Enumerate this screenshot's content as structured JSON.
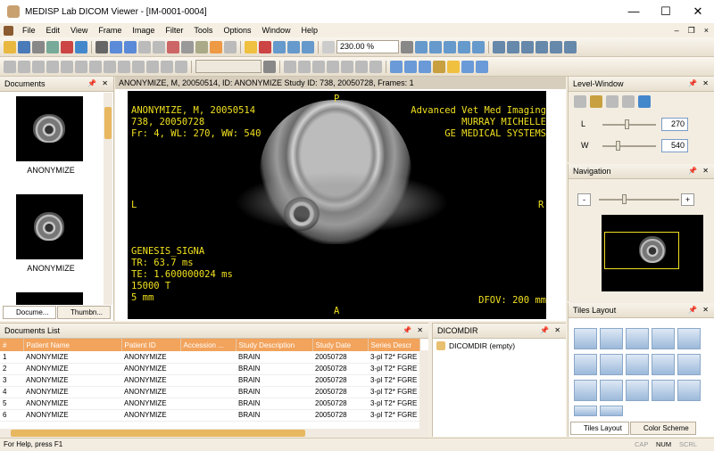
{
  "window": {
    "title": "MEDISP Lab DICOM Viewer - [IM-0001-0004]",
    "min": "—",
    "max": "☐",
    "close": "✕"
  },
  "menu": [
    "File",
    "Edit",
    "View",
    "Frame",
    "Image",
    "Filter",
    "Tools",
    "Options",
    "Window",
    "Help"
  ],
  "mdi": {
    "min": "–",
    "restore": "❐",
    "close": "×"
  },
  "toolbar": {
    "zoom": "230.00 %"
  },
  "documents": {
    "title": "Documents",
    "thumb_label_1": "ANONYMIZE",
    "thumb_label_2": "ANONYMIZE",
    "tab1": "Docume...",
    "tab2": "Thumbn..."
  },
  "viewer": {
    "header": "ANONYMIZE, M, 20050514, ID: ANONYMIZE   Study ID: 738, 20050728, Frames: 1",
    "top_left": "ANONYMIZE, M, 20050514\n738, 20050728\nFr: 4, WL: 270, WW: 540",
    "top_right": "Advanced Vet Med Imaging\nMURRAY MICHELLE\nGE MEDICAL SYSTEMS",
    "bottom_left": "GENESIS_SIGNA\nTR: 63.7 ms\nTE: 1.600000024 ms\n15000 T\n5 mm",
    "bottom_right": "DFOV: 200 mm",
    "ori_top": "P",
    "ori_bottom": "A",
    "ori_left": "L",
    "ori_right": "R"
  },
  "doclist": {
    "title": "Documents List",
    "columns": [
      "#",
      "Patient Name",
      "Patient ID",
      "Accession ...",
      "Study Description",
      "Study Date",
      "Series Descr"
    ],
    "rows": [
      [
        "1",
        "ANONYMIZE",
        "ANONYMIZE",
        "",
        "BRAIN",
        "20050728",
        "3-pl T2* FGRE"
      ],
      [
        "2",
        "ANONYMIZE",
        "ANONYMIZE",
        "",
        "BRAIN",
        "20050728",
        "3-pl T2* FGRE"
      ],
      [
        "3",
        "ANONYMIZE",
        "ANONYMIZE",
        "",
        "BRAIN",
        "20050728",
        "3-pl T2* FGRE"
      ],
      [
        "4",
        "ANONYMIZE",
        "ANONYMIZE",
        "",
        "BRAIN",
        "20050728",
        "3-pl T2* FGRE"
      ],
      [
        "5",
        "ANONYMIZE",
        "ANONYMIZE",
        "",
        "BRAIN",
        "20050728",
        "3-pl T2* FGRE"
      ],
      [
        "6",
        "ANONYMIZE",
        "ANONYMIZE",
        "",
        "BRAIN",
        "20050728",
        "3-pl T2* FGRE"
      ]
    ]
  },
  "dicomdir": {
    "title": "DICOMDIR",
    "item": "DICOMDIR (empty)"
  },
  "level": {
    "title": "Level-Window",
    "l_label": "L",
    "w_label": "W",
    "l_value": "270",
    "w_value": "540"
  },
  "nav": {
    "title": "Navigation",
    "minus": "-",
    "plus": "+"
  },
  "tiles": {
    "title": "Tiles Layout",
    "tab1": "Tiles Layout",
    "tab2": "Color Scheme"
  },
  "status": {
    "help": "For Help, press F1",
    "cap": "CAP",
    "num": "NUM",
    "scrl": "SCRL"
  }
}
